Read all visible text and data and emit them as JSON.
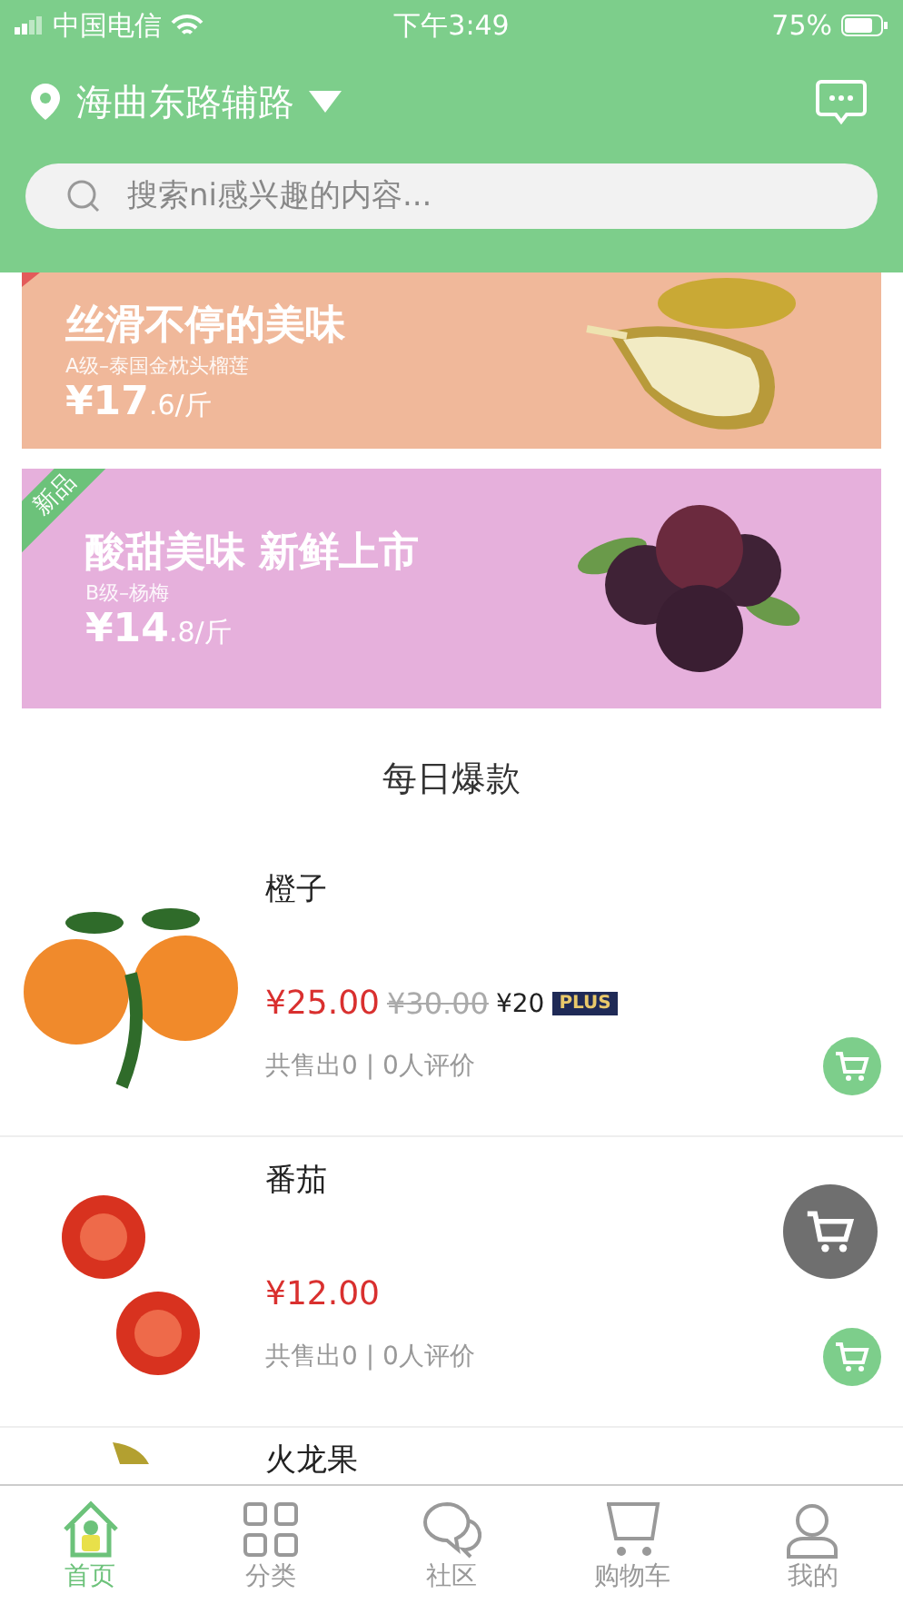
{
  "status_bar": {
    "carrier": "中国电信",
    "time": "下午3:49",
    "battery": "75%"
  },
  "header": {
    "location": "海曲东路辅路",
    "search": {
      "placeholder": "搜索ni感兴趣的内容..."
    }
  },
  "banners": [
    {
      "title": "丝滑不停的美味",
      "subtitle": "A级–泰国金枕头榴莲",
      "price_main": "¥17",
      "price_tail": ".6/斤",
      "color": "#f0b89a"
    },
    {
      "title": "酸甜美味 新鲜上市",
      "subtitle": "B级–杨梅",
      "price_main": "¥14",
      "price_tail": ".8/斤",
      "tag": "新品",
      "color": "#e6b0dc"
    }
  ],
  "section_title": "每日爆款",
  "products": [
    {
      "name": "橙子",
      "price": "¥25.00",
      "original_price": "¥30.00",
      "member_price": "¥20",
      "member_badge": "PLUS",
      "stats": "共售出0 | 0人评价"
    },
    {
      "name": "番茄",
      "price": "¥12.00",
      "stats": "共售出0 | 0人评价"
    },
    {
      "name": "火龙果"
    }
  ],
  "tabs": [
    {
      "label": "首页",
      "selected": true
    },
    {
      "label": "分类",
      "selected": false
    },
    {
      "label": "社区",
      "selected": false
    },
    {
      "label": "购物车",
      "selected": false
    },
    {
      "label": "我的",
      "selected": false
    }
  ]
}
